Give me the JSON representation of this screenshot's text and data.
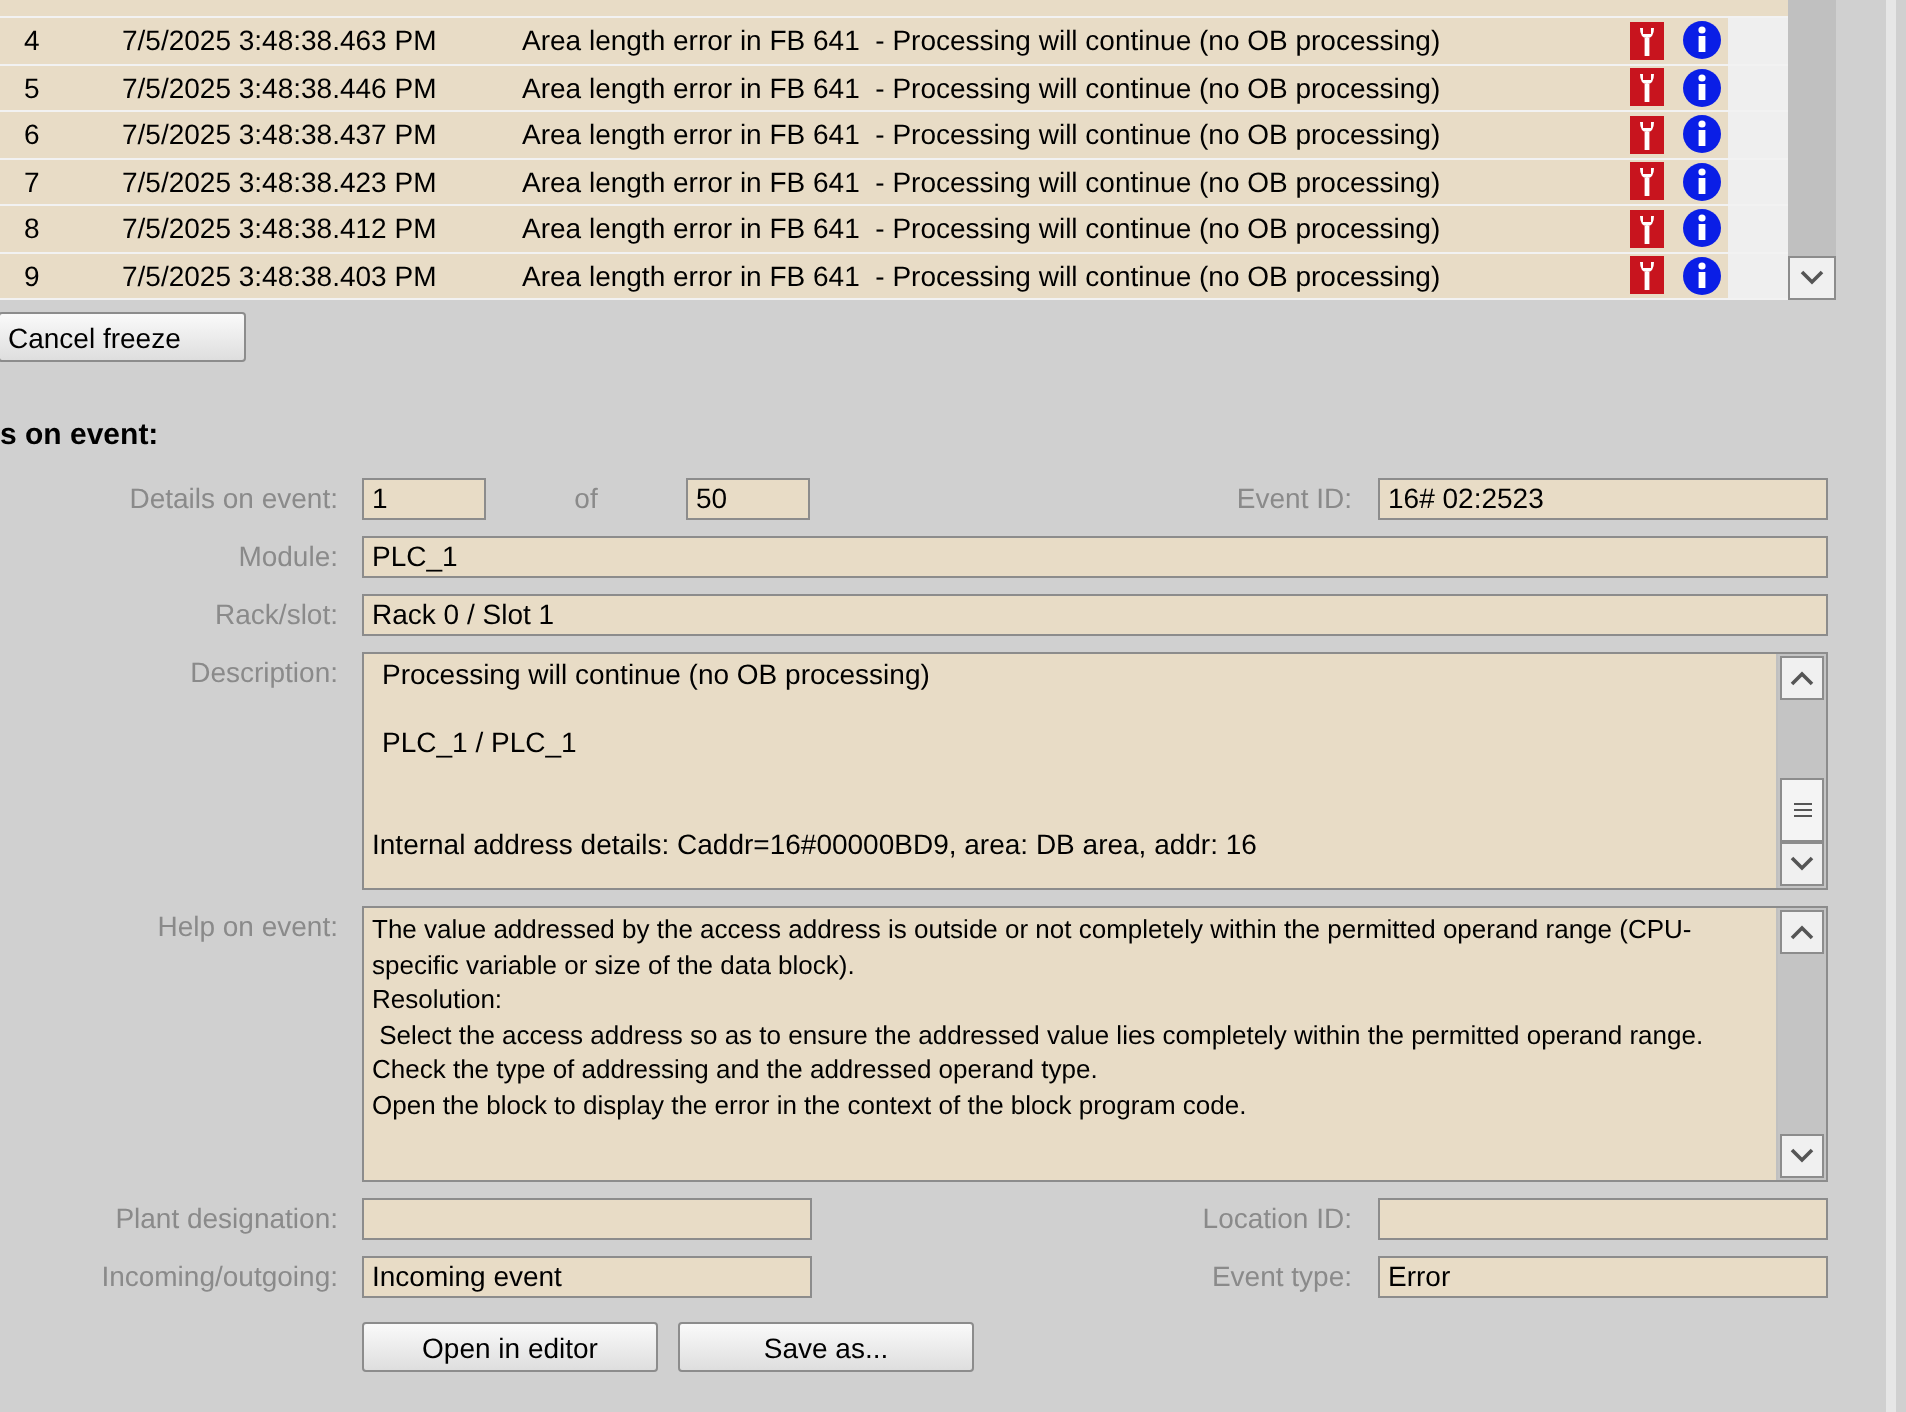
{
  "events": {
    "rows": [
      {
        "number": "4",
        "time": "7/5/2025 3:48:38.463 PM",
        "message": "Area length error in FB 641  - Processing will continue (no OB processing)"
      },
      {
        "number": "5",
        "time": "7/5/2025 3:48:38.446 PM",
        "message": "Area length error in FB 641  - Processing will continue (no OB processing)"
      },
      {
        "number": "6",
        "time": "7/5/2025 3:48:38.437 PM",
        "message": "Area length error in FB 641  - Processing will continue (no OB processing)"
      },
      {
        "number": "7",
        "time": "7/5/2025 3:48:38.423 PM",
        "message": "Area length error in FB 641  - Processing will continue (no OB processing)"
      },
      {
        "number": "8",
        "time": "7/5/2025 3:48:38.412 PM",
        "message": "Area length error in FB 641  - Processing will continue (no OB processing)"
      },
      {
        "number": "9",
        "time": "7/5/2025 3:48:38.403 PM",
        "message": "Area length error in FB 641  - Processing will continue (no OB processing)"
      }
    ]
  },
  "cancel_freeze_button": "Cancel freeze",
  "details": {
    "heading": "s on event:",
    "details_on_event": {
      "label": "Details on event:",
      "current": "1",
      "of": "of",
      "total": "50"
    },
    "event_id": {
      "label": "Event ID:",
      "value": "16# 02:2523"
    },
    "module": {
      "label": "Module:",
      "value": "PLC_1"
    },
    "rack_slot": {
      "label": "Rack/slot:",
      "value": "Rack 0 / Slot 1"
    },
    "description": {
      "label": "Description:",
      "paragraphs": [
        "Processing will continue (no OB processing)",
        "PLC_1 / PLC_1",
        "Internal address details: Caddr=16#00000BD9, area: DB area, addr: 16"
      ]
    },
    "help_on_event": {
      "label": "Help on event:",
      "paragraphs": [
        "The value addressed by the access address is outside or not completely within the permitted operand range (CPU-specific variable or size of the data block).",
        "Resolution:",
        " Select the access address so as to ensure the addressed value lies completely within the permitted operand range. Check the type of addressing and the addressed operand type.",
        "Open the block to display the error in the context of the block program code."
      ]
    },
    "plant_designation": {
      "label": "Plant designation:"
    },
    "location_id": {
      "label": "Location ID:"
    },
    "incoming_outgoing": {
      "label": "Incoming/outgoing:",
      "value": "Incoming event"
    },
    "event_type": {
      "label": "Event type:",
      "value": "Error"
    },
    "buttons": [
      "Open in editor",
      "Save as..."
    ]
  }
}
